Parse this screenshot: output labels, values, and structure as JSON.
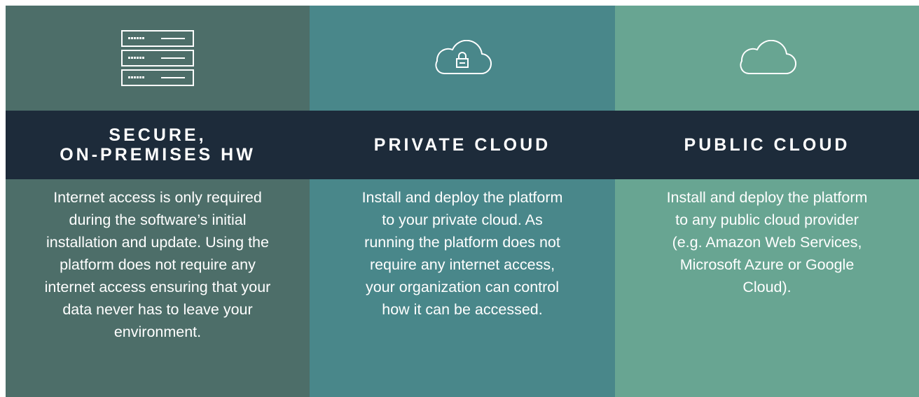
{
  "columns": [
    {
      "icon": "server-rack-icon",
      "title_lines": [
        "SECURE,",
        "ON-PREMISES HW"
      ],
      "description": "Internet access is only required during the software’s initial installation and update. Using the platform does not require any internet access ensuring that your data never has to leave your environment.",
      "bg_color": "#4d6e69"
    },
    {
      "icon": "cloud-lock-icon",
      "title_lines": [
        "PRIVATE CLOUD"
      ],
      "description": "Install and deploy the platform to your private cloud. As running the platform does not require any internet access, your organization can control how it can be accessed.",
      "bg_color": "#49878a"
    },
    {
      "icon": "cloud-icon",
      "title_lines": [
        "PUBLIC CLOUD"
      ],
      "description": "Install and deploy the platform to any public cloud provider (e.g. Amazon Web Services, Microsoft Azure or Google Cloud).",
      "bg_color": "#68a592"
    }
  ],
  "band_color": "#1d2b3a"
}
